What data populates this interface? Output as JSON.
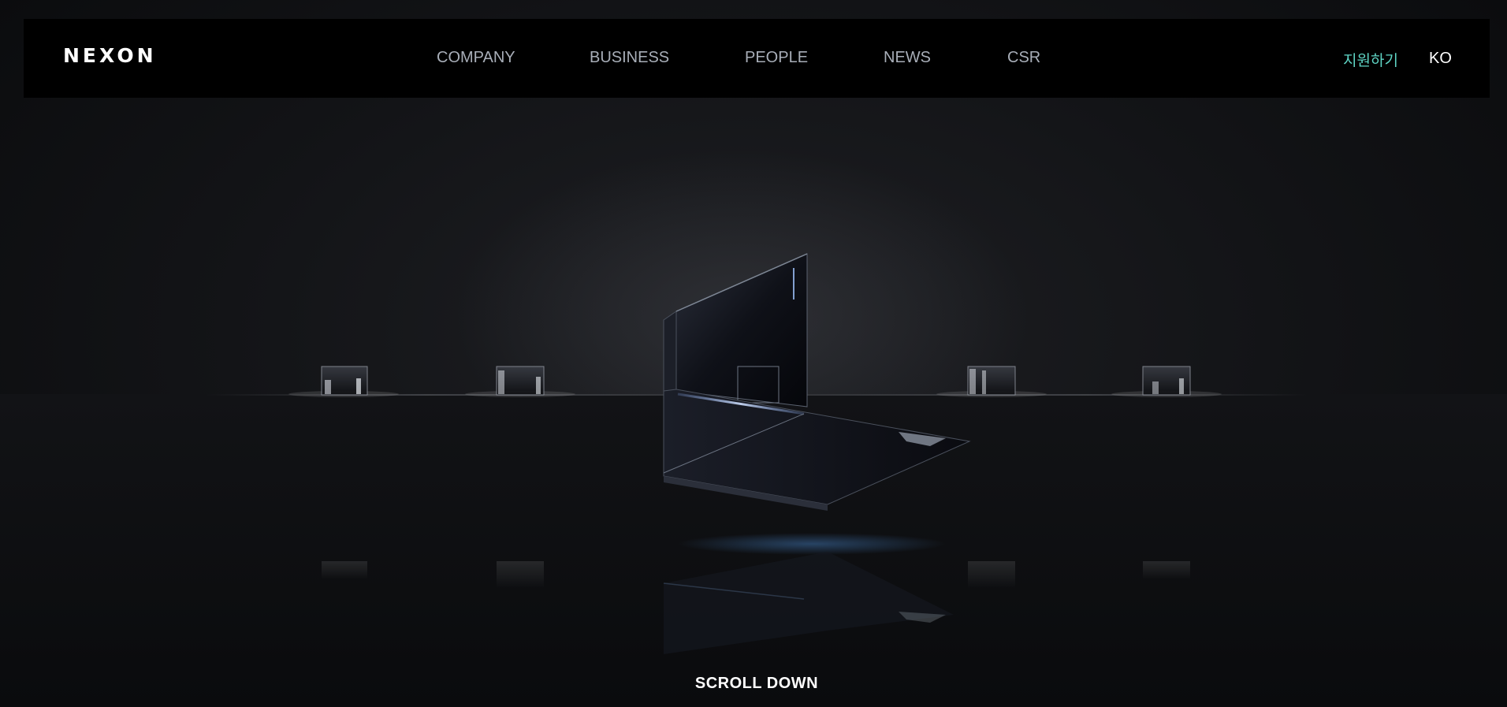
{
  "header": {
    "logo_text": "NEXON",
    "nav": [
      {
        "label": "COMPANY"
      },
      {
        "label": "BUSINESS"
      },
      {
        "label": "PEOPLE"
      },
      {
        "label": "NEWS"
      },
      {
        "label": "CSR"
      }
    ],
    "apply_label": "지원하기",
    "lang_label": "KO"
  },
  "hero": {
    "scroll_label": "SCROLL DOWN"
  },
  "colors": {
    "background": "#0c0d10",
    "header_bg": "#000000",
    "nav_text": "#a8aeb8",
    "accent": "#5fd6c6",
    "text_white": "#ffffff"
  }
}
